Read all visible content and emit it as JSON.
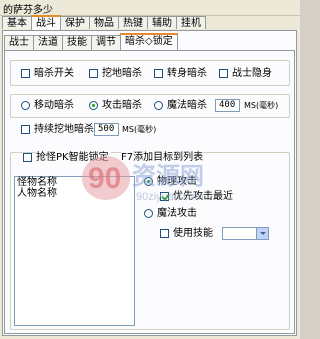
{
  "window": {
    "title": "的萨芬多少"
  },
  "main_tabs": [
    "基本",
    "战斗",
    "保护",
    "物品",
    "热键",
    "辅助",
    "挂机"
  ],
  "sub_tabs": [
    "战士",
    "法道",
    "技能",
    "调节",
    "暗杀◇锁定"
  ],
  "row1": {
    "assassin_switch": "暗杀开关",
    "dig_assassin": "挖地暗杀",
    "teleport_assassin": "转身暗杀",
    "warrior_stealth": "战士隐身"
  },
  "row2": {
    "move_assassin": "移动暗杀",
    "attack_assassin": "攻击暗杀",
    "magic_assassin": "魔法暗杀",
    "magic_value": "400",
    "magic_unit": "MS(毫秒)"
  },
  "row3": {
    "continuous_dig": "持续挖地暗杀",
    "dig_value": "500",
    "dig_unit": "MS(毫秒)"
  },
  "lock_group": {
    "smart_lock": "抢怪PK智能锁定",
    "f7_hint": "F7添加目标到列表"
  },
  "target_list": {
    "items": [
      "怪物名称",
      "人物名称"
    ]
  },
  "options": {
    "physical_attack": "物理攻击",
    "priority_nearest": "优先攻击最近",
    "magic_attack": "魔法攻击",
    "use_skill": "使用技能",
    "skill_selected": ""
  },
  "watermark": {
    "big": "资源网",
    "small": "90ziyuan.com"
  }
}
